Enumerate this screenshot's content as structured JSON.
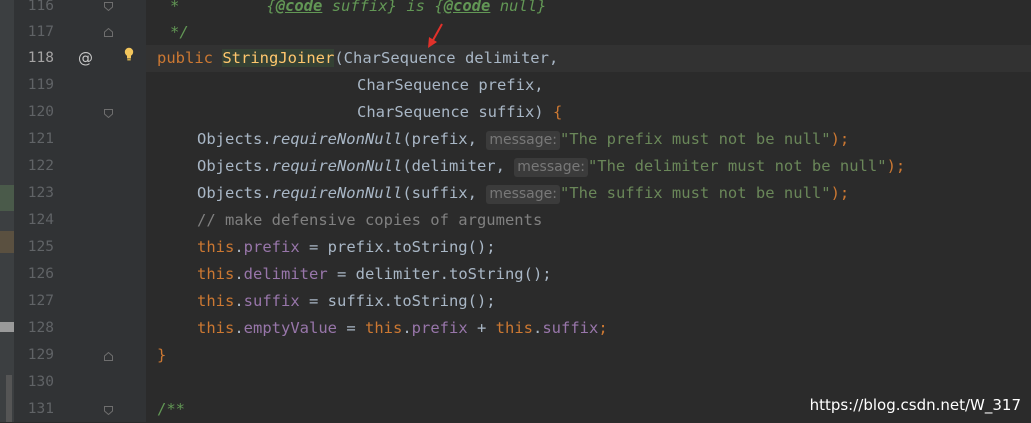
{
  "editor": {
    "lines": [
      {
        "num": "116",
        "text": "*         {@code suffix} is {@code null}"
      },
      {
        "num": "117",
        "text": "*/"
      },
      {
        "num": "118",
        "text": "public StringJoiner(CharSequence delimiter,"
      },
      {
        "num": "119",
        "text": "CharSequence prefix,"
      },
      {
        "num": "120",
        "text": "CharSequence suffix) {"
      },
      {
        "num": "121",
        "text": "Objects.requireNonNull(prefix, message: \"The prefix must not be null\");"
      },
      {
        "num": "122",
        "text": "Objects.requireNonNull(delimiter, message: \"The delimiter must not be null\");"
      },
      {
        "num": "123",
        "text": "Objects.requireNonNull(suffix, message: \"The suffix must not be null\");"
      },
      {
        "num": "124",
        "text": "// make defensive copies of arguments"
      },
      {
        "num": "125",
        "text": "this.prefix = prefix.toString();"
      },
      {
        "num": "126",
        "text": "this.delimiter = delimiter.toString();"
      },
      {
        "num": "127",
        "text": "this.suffix = suffix.toString();"
      },
      {
        "num": "128",
        "text": "this.emptyValue = this.prefix + this.suffix;"
      },
      {
        "num": "129",
        "text": "}"
      },
      {
        "num": "130",
        "text": ""
      },
      {
        "num": "131",
        "text": "/**"
      }
    ],
    "gutter": {
      "override_marker": "@",
      "icons": [
        "at-icon",
        "lightbulb-icon",
        "fold-icon"
      ]
    }
  },
  "tokens": {
    "l116a": "*",
    "l116b": "{",
    "l116c": "@code",
    "l116d": " suffix} is {",
    "l116e": "@code",
    "l116f": " null}",
    "l117": "*/",
    "l118_public": "public",
    "l118_name": "StringJoiner",
    "l118_rest": "(CharSequence delimiter,",
    "l119": "CharSequence prefix,",
    "l120a": "CharSequence suffix) ",
    "l120b": "{",
    "objects": "Objects.",
    "rnn": "requireNonNull",
    "l121_arg": "(prefix, ",
    "l121_str": "\"The prefix must not be null\"",
    "l122_arg": "(delimiter, ",
    "l122_str": "\"The delimiter must not be null\"",
    "l123_arg": "(suffix, ",
    "l123_str": "\"The suffix must not be null\"",
    "hint": "message:",
    "close": ");",
    "l124": "// make defensive copies of arguments",
    "this": "this",
    "dot": ".",
    "prefix": "prefix",
    "delimiter": "delimiter",
    "suffix": "suffix",
    "emptyValue": "emptyValue",
    "l125_rest": " = prefix.toString();",
    "l126_rest": " = delimiter.toString();",
    "l127_rest": " = suffix.toString();",
    "eq": " = ",
    "plus": " + ",
    "semi": ";",
    "l129": "}",
    "l131": "/**"
  },
  "watermark": "https://blog.csdn.net/W_317",
  "colors": {
    "background": "#2b2b2b",
    "gutter": "#313335",
    "keyword": "#cc7832",
    "field": "#9876aa",
    "string": "#6a8759",
    "comment": "#808080",
    "method_decl": "#ffc66d",
    "arrow": "#e0312a"
  }
}
